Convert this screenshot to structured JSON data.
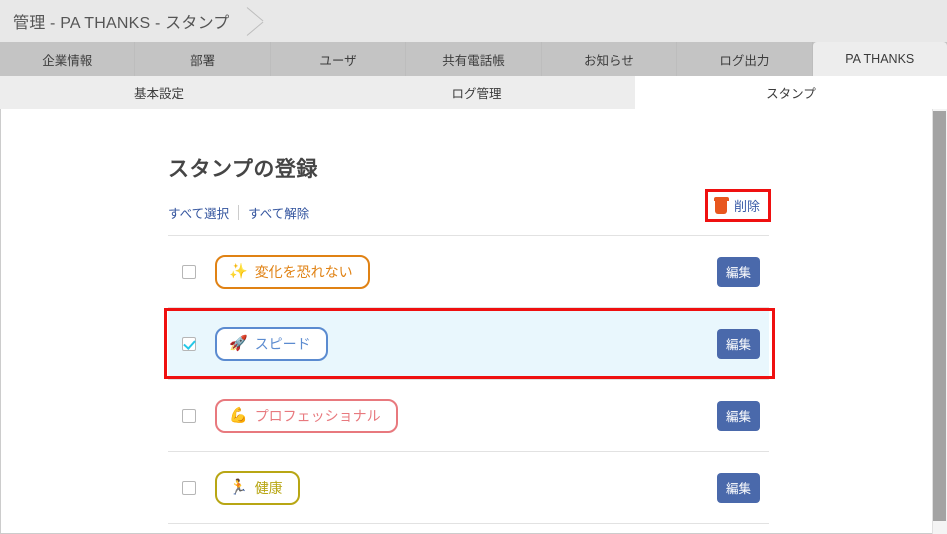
{
  "breadcrumb": {
    "text": "管理 - PA THANKS - スタンプ"
  },
  "tabs": [
    {
      "label": "企業情報",
      "active": false
    },
    {
      "label": "部署",
      "active": false
    },
    {
      "label": "ユーザ",
      "active": false
    },
    {
      "label": "共有電話帳",
      "active": false
    },
    {
      "label": "お知らせ",
      "active": false
    },
    {
      "label": "ログ出力",
      "active": false
    },
    {
      "label": "PA THANKS",
      "active": true
    }
  ],
  "subtabs": [
    {
      "label": "基本設定",
      "active": false
    },
    {
      "label": "ログ管理",
      "active": false
    },
    {
      "label": "スタンプ",
      "active": true
    }
  ],
  "main": {
    "title": "スタンプの登録",
    "select_all_label": "すべて選択",
    "deselect_all_label": "すべて解除",
    "delete_label": "削除",
    "delete_icon": "trash-icon",
    "edit_label": "編集"
  },
  "stamps": [
    {
      "emoji": "✨",
      "icon_name": "sparkles-icon",
      "label": "変化を恐れない",
      "color": "#e08214",
      "checked": false,
      "highlighted": false
    },
    {
      "emoji": "🚀",
      "icon_name": "rocket-icon",
      "label": "スピード",
      "color": "#5b8bd0",
      "checked": true,
      "highlighted": true
    },
    {
      "emoji": "💪",
      "icon_name": "flexed-biceps-icon",
      "label": "プロフェッショナル",
      "color": "#e8797e",
      "checked": false,
      "highlighted": false
    },
    {
      "emoji": "🏃",
      "icon_name": "runner-icon",
      "label": "健康",
      "color": "#b8a614",
      "checked": false,
      "highlighted": false
    }
  ],
  "colors": {
    "link": "#33549e",
    "edit_button": "#4a69ab",
    "highlight_border": "#ef1010",
    "selected_row_bg": "#e9f7fd",
    "trash": "#e8561e"
  }
}
